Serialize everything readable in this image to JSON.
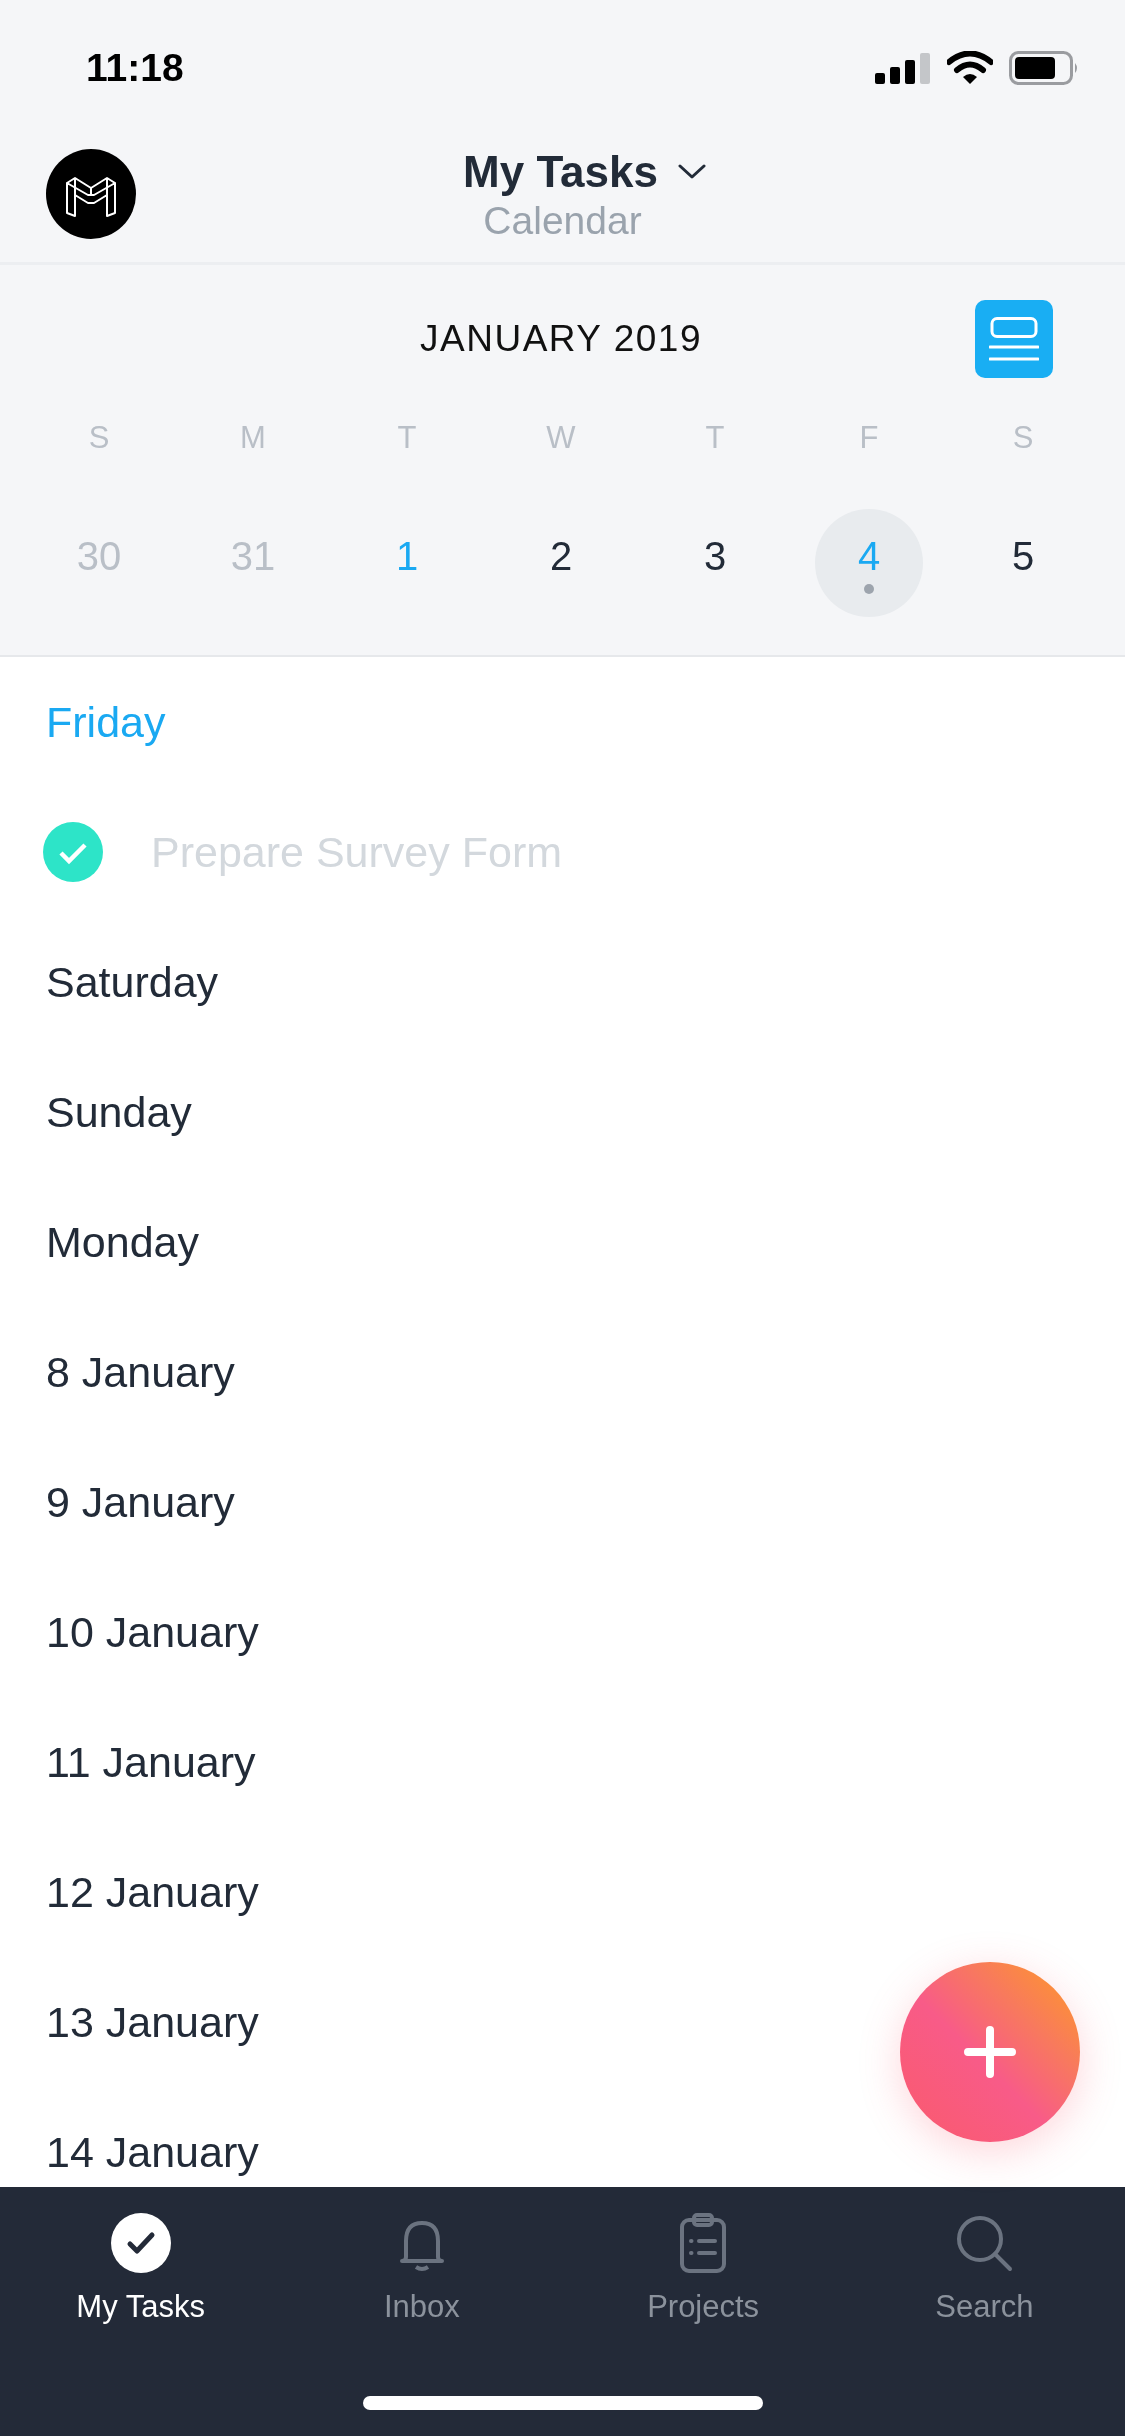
{
  "status_bar": {
    "time": "11:18"
  },
  "header": {
    "title": "My Tasks",
    "subtitle": "Calendar"
  },
  "calendar": {
    "month": "JANUARY 2019",
    "weekdays": [
      "S",
      "M",
      "T",
      "W",
      "T",
      "F",
      "S"
    ],
    "days": [
      {
        "label": "30",
        "outside_month": true,
        "highlighted": false,
        "selected": false,
        "has_tasks": false
      },
      {
        "label": "31",
        "outside_month": true,
        "highlighted": false,
        "selected": false,
        "has_tasks": false
      },
      {
        "label": "1",
        "outside_month": false,
        "highlighted": true,
        "selected": false,
        "has_tasks": false
      },
      {
        "label": "2",
        "outside_month": false,
        "highlighted": false,
        "selected": false,
        "has_tasks": false
      },
      {
        "label": "3",
        "outside_month": false,
        "highlighted": false,
        "selected": false,
        "has_tasks": false
      },
      {
        "label": "4",
        "outside_month": false,
        "highlighted": true,
        "selected": true,
        "has_tasks": true
      },
      {
        "label": "5",
        "outside_month": false,
        "highlighted": false,
        "selected": false,
        "has_tasks": false
      }
    ]
  },
  "agenda": [
    {
      "heading": "Friday",
      "current": true,
      "tasks": [
        {
          "title": "Prepare Survey Form",
          "done": true
        }
      ]
    },
    {
      "heading": "Saturday",
      "current": false
    },
    {
      "heading": "Sunday",
      "current": false
    },
    {
      "heading": "Monday",
      "current": false
    },
    {
      "heading": "8 January",
      "current": false
    },
    {
      "heading": "9 January",
      "current": false
    },
    {
      "heading": "10 January",
      "current": false
    },
    {
      "heading": "11 January",
      "current": false
    },
    {
      "heading": "12 January",
      "current": false
    },
    {
      "heading": "13 January",
      "current": false
    },
    {
      "heading": "14 January",
      "current": false
    }
  ],
  "tab_bar": [
    {
      "label": "My Tasks",
      "kind": "tasks",
      "selected": true
    },
    {
      "label": "Inbox",
      "kind": "inbox",
      "selected": false
    },
    {
      "label": "Projects",
      "kind": "projects",
      "selected": false
    },
    {
      "label": "Search",
      "kind": "search",
      "selected": false
    }
  ]
}
